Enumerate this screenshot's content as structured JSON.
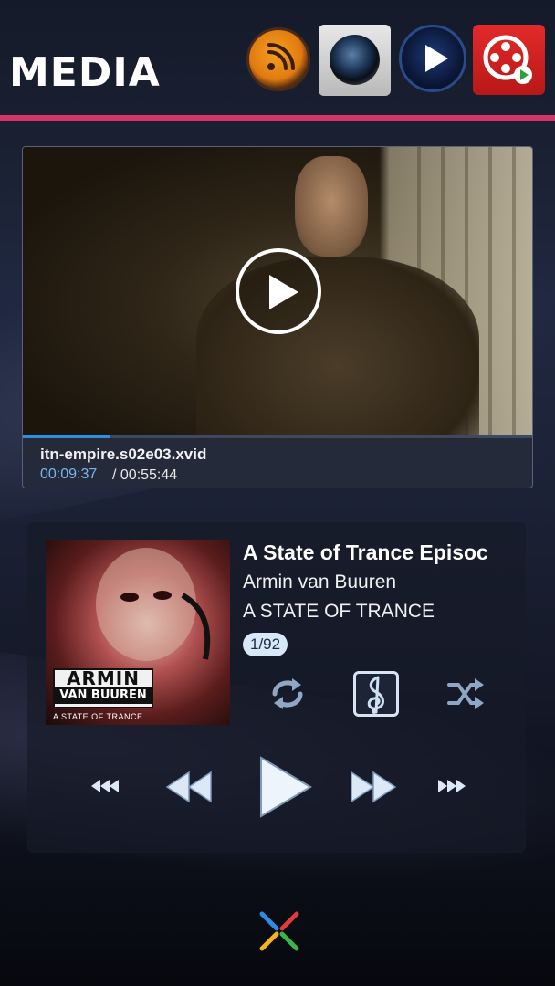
{
  "header": {
    "title": "MEDIA",
    "accent_color": "#d4366c",
    "apps": [
      {
        "name": "rss-feed",
        "icon": "rss-icon"
      },
      {
        "name": "camera",
        "icon": "camera-icon"
      },
      {
        "name": "video-player",
        "icon": "play-icon"
      },
      {
        "name": "video-player-2",
        "icon": "film-reel-icon"
      }
    ]
  },
  "video": {
    "filename": "itn-empire.s02e03.xvid",
    "current_time": "00:09:37",
    "total_time": "/ 00:55:44",
    "progress_fraction": 0.1726,
    "progress_color": "#2e8fe0"
  },
  "music": {
    "title": "A State of Trance Episoc",
    "artist": "Armin van Buuren",
    "album": "A STATE OF TRANCE",
    "track_index": "1/92",
    "album_art": {
      "logo_line1": "ARMIN",
      "logo_line2": "VAN BUUREN",
      "subtitle": "A STATE OF TRANCE"
    },
    "controls": [
      "repeat-icon",
      "treble-clef-icon",
      "shuffle-icon",
      "skip-back-icon",
      "rewind-icon",
      "play-icon",
      "fast-forward-icon",
      "skip-forward-icon"
    ]
  },
  "footer": {
    "icon": "launcher-x-icon"
  }
}
